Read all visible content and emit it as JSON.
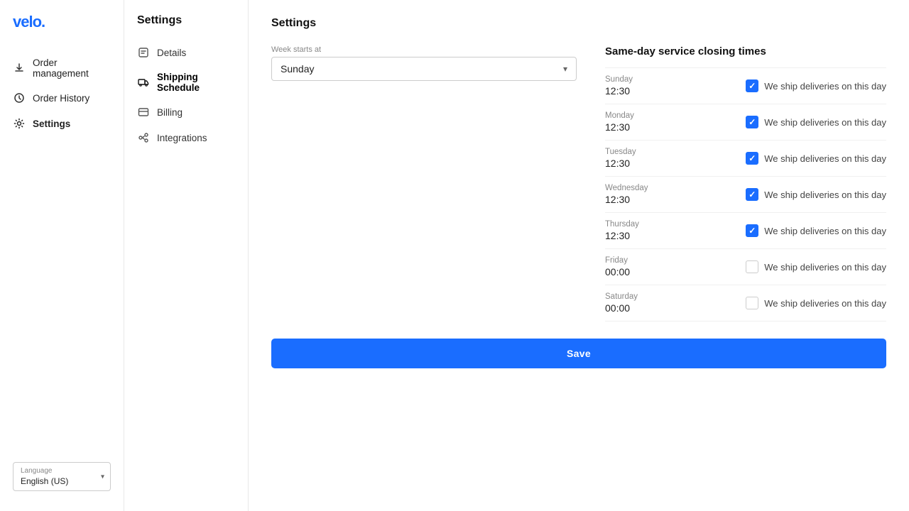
{
  "brand": {
    "name": "velo.",
    "color": "#1a6dff"
  },
  "sidebar": {
    "nav_items": [
      {
        "id": "order-management",
        "label": "Order management",
        "icon": "download-icon"
      },
      {
        "id": "order-history",
        "label": "Order History",
        "icon": "history-icon"
      },
      {
        "id": "settings",
        "label": "Settings",
        "icon": "gear-icon",
        "active": true
      }
    ],
    "language_label": "Language",
    "language_value": "English (US)"
  },
  "settings_nav": {
    "title": "Settings",
    "items": [
      {
        "id": "details",
        "label": "Details",
        "icon": "details-icon"
      },
      {
        "id": "shipping-schedule",
        "label": "Shipping Schedule",
        "icon": "truck-icon",
        "active": true
      },
      {
        "id": "billing",
        "label": "Billing",
        "icon": "billing-icon"
      },
      {
        "id": "integrations",
        "label": "Integrations",
        "icon": "integrations-icon"
      }
    ]
  },
  "main": {
    "title": "Settings",
    "week_starts_at_label": "Week starts at",
    "week_starts_at_value": "Sunday",
    "same_day_title": "Same-day service closing times",
    "days": [
      {
        "name": "Sunday",
        "time": "12:30",
        "checked": true
      },
      {
        "name": "Monday",
        "time": "12:30",
        "checked": true
      },
      {
        "name": "Tuesday",
        "time": "12:30",
        "checked": true
      },
      {
        "name": "Wednesday",
        "time": "12:30",
        "checked": true
      },
      {
        "name": "Thursday",
        "time": "12:30",
        "checked": true
      },
      {
        "name": "Friday",
        "time": "00:00",
        "checked": false
      },
      {
        "name": "Saturday",
        "time": "00:00",
        "checked": false
      }
    ],
    "ship_label": "We ship deliveries on this day",
    "save_label": "Save"
  },
  "colors": {
    "accent": "#1a6dff"
  }
}
